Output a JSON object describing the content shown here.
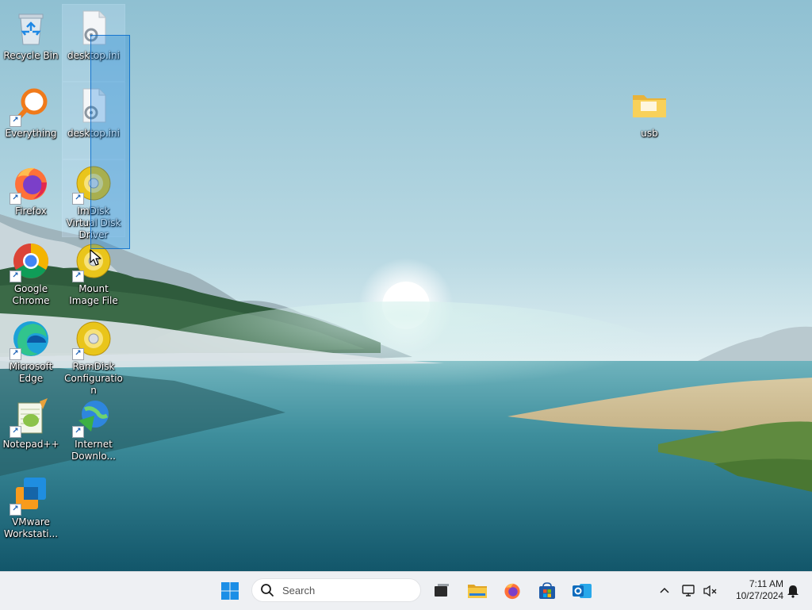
{
  "desktop": {
    "icons": [
      {
        "id": "recycle-bin",
        "label": "Recycle Bin",
        "icon": "recycle-bin-icon"
      },
      {
        "id": "desktop-ini-1",
        "label": "desktop.ini",
        "icon": "file-gear-icon"
      },
      {
        "id": "everything",
        "label": "Everything",
        "icon": "magnifier-icon"
      },
      {
        "id": "desktop-ini-2",
        "label": "desktop.ini",
        "icon": "file-gear-icon"
      },
      {
        "id": "firefox",
        "label": "Firefox",
        "icon": "firefox-icon"
      },
      {
        "id": "imdisk",
        "label": "ImDisk Virtual Disk Driver",
        "icon": "disc-icon"
      },
      {
        "id": "chrome",
        "label": "Google Chrome",
        "icon": "chrome-icon"
      },
      {
        "id": "mount-image",
        "label": "Mount Image File",
        "icon": "disc-icon"
      },
      {
        "id": "edge",
        "label": "Microsoft Edge",
        "icon": "edge-icon"
      },
      {
        "id": "ramdisk",
        "label": "RamDisk Configuration",
        "icon": "disc-icon"
      },
      {
        "id": "notepadpp",
        "label": "Notepad++",
        "icon": "notepadpp-icon"
      },
      {
        "id": "idm",
        "label": "Internet Downlo...",
        "icon": "idm-globe-icon"
      },
      {
        "id": "vmware",
        "label": "VMware Workstati...",
        "icon": "vmware-icon"
      },
      {
        "id": "usb",
        "label": "usb",
        "icon": "folder-icon"
      }
    ]
  },
  "taskbar": {
    "search_placeholder": "Search",
    "apps": [
      "start-button",
      "search-box",
      "task-view",
      "file-explorer",
      "firefox",
      "microsoft-store",
      "outlook"
    ],
    "tray": {
      "time": "7:11 AM",
      "date": "10/27/2024"
    }
  },
  "colors": {
    "selection": "#0078d7",
    "taskbar_bg": "#eef0f3",
    "folder": "#f4c542"
  }
}
